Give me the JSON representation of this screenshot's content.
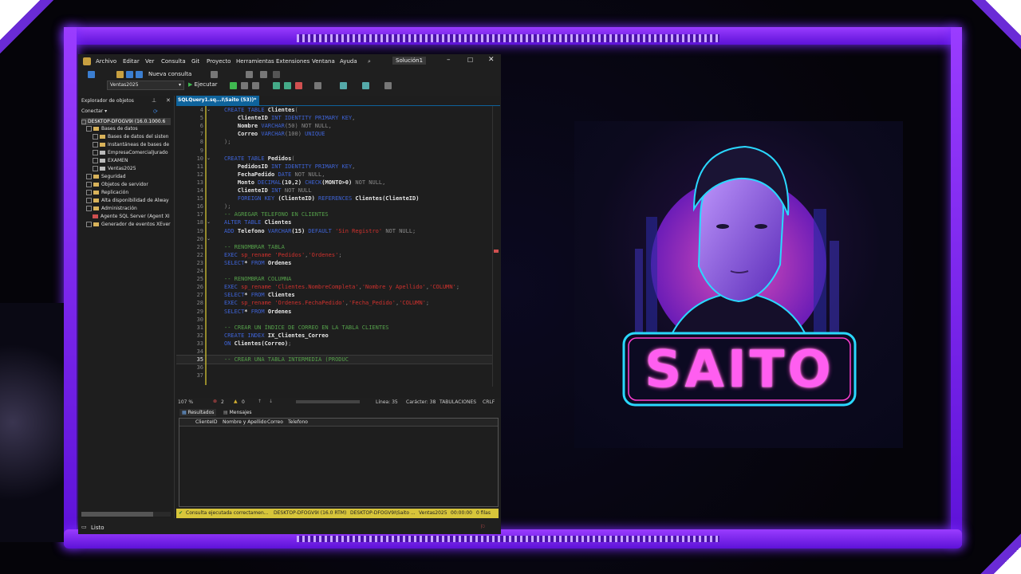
{
  "menu": {
    "items": [
      "Archivo",
      "Editar",
      "Ver",
      "Consulta",
      "Git",
      "Proyecto",
      "Herramientas",
      "Extensiones",
      "Ventana",
      "Ayuda"
    ],
    "solution_badge": "Solución1"
  },
  "toolbar": {
    "new_query": "Nueva consulta",
    "database": "Ventas2025",
    "execute": "Ejecutar"
  },
  "object_explorer": {
    "title": "Explorador de objetos",
    "connect": "Conectar",
    "server": "DESKTOP-DFOGV9I (16.0.1000.6",
    "items": [
      "Bases de datos",
      "Bases de datos del sisten",
      "Instantáneas de bases de",
      "EmpresaComercialJurado",
      "EXAMEN",
      "Ventas2025",
      "Seguridad",
      "Objetos de servidor",
      "Replicación",
      "Alta disponibilidad de Alway",
      "Administración",
      "Agente SQL Server (Agent XI",
      "Generador de eventos XEver"
    ]
  },
  "editor": {
    "tab_label": "SQLQuery1.sq...I\\Saito (53))*",
    "lines": [
      {
        "n": "4",
        "parts": [
          [
            "kw",
            "CREATE TABLE "
          ],
          [
            "tb",
            "Clientes"
          ],
          [
            "gr",
            "("
          ]
        ]
      },
      {
        "n": "5",
        "parts": [
          [
            "tb",
            "    ClienteID "
          ],
          [
            "kw",
            "INT IDENTITY PRIMARY KEY"
          ],
          [
            "gr",
            ","
          ]
        ]
      },
      {
        "n": "6",
        "parts": [
          [
            "tb",
            "    Nombre "
          ],
          [
            "kw",
            "VARCHAR"
          ],
          [
            "gr",
            "(50) NOT NULL,"
          ]
        ]
      },
      {
        "n": "7",
        "parts": [
          [
            "tb",
            "    Correo "
          ],
          [
            "kw",
            "VARCHAR"
          ],
          [
            "gr",
            "(100) "
          ],
          [
            "kw",
            "UNIQUE"
          ]
        ]
      },
      {
        "n": "8",
        "parts": [
          [
            "gr",
            ");"
          ]
        ]
      },
      {
        "n": "9",
        "parts": [
          [
            "gr",
            ""
          ]
        ]
      },
      {
        "n": "10",
        "parts": [
          [
            "kw",
            "CREATE TABLE "
          ],
          [
            "tb",
            "Pedidos"
          ],
          [
            "gr",
            "("
          ]
        ]
      },
      {
        "n": "11",
        "parts": [
          [
            "tb",
            "    PedidosID "
          ],
          [
            "kw",
            "INT IDENTITY PRIMARY KEY"
          ],
          [
            "gr",
            ","
          ]
        ]
      },
      {
        "n": "12",
        "parts": [
          [
            "tb",
            "    FechaPedido "
          ],
          [
            "kw",
            "DATE"
          ],
          [
            "gr",
            " NOT NULL,"
          ]
        ]
      },
      {
        "n": "13",
        "parts": [
          [
            "tb",
            "    Monto "
          ],
          [
            "kw",
            "DECIMAL"
          ],
          [
            "tb",
            "(10,2) "
          ],
          [
            "kw",
            "CHECK"
          ],
          [
            "tb",
            "(MONTO>0)"
          ],
          [
            "gr",
            " NOT NULL,"
          ]
        ]
      },
      {
        "n": "14",
        "parts": [
          [
            "tb",
            "    ClienteID "
          ],
          [
            "kw",
            "INT"
          ],
          [
            "gr",
            " NOT NULL"
          ]
        ]
      },
      {
        "n": "15",
        "parts": [
          [
            "kw",
            "    FOREIGN KEY "
          ],
          [
            "tb",
            "(ClienteID) "
          ],
          [
            "kw",
            "REFERENCES "
          ],
          [
            "tb",
            "Clientes(ClienteID)"
          ]
        ]
      },
      {
        "n": "16",
        "parts": [
          [
            "gr",
            ");"
          ]
        ]
      },
      {
        "n": "17",
        "parts": [
          [
            "cm",
            "-- AGREGAR TELEFONO EN CLIENTES"
          ]
        ]
      },
      {
        "n": "18",
        "parts": [
          [
            "kw",
            "ALTER TABLE "
          ],
          [
            "tb",
            "Clientes"
          ]
        ]
      },
      {
        "n": "19",
        "parts": [
          [
            "kw",
            "ADD "
          ],
          [
            "tb",
            "Telefono "
          ],
          [
            "kw",
            "VARCHAR"
          ],
          [
            "tb",
            "(15) "
          ],
          [
            "kw",
            "DEFAULT "
          ],
          [
            "str",
            "'Sin Registro'"
          ],
          [
            "gr",
            " NOT NULL;"
          ]
        ]
      },
      {
        "n": "20",
        "parts": [
          [
            "gr",
            ""
          ]
        ]
      },
      {
        "n": "21",
        "parts": [
          [
            "cm",
            "-- RENOMBRAR TABLA"
          ]
        ]
      },
      {
        "n": "22",
        "parts": [
          [
            "kw",
            "EXEC "
          ],
          [
            "str",
            "sp_rename "
          ],
          [
            "str",
            "'Pedidos'"
          ],
          [
            "gr",
            ","
          ],
          [
            "str",
            "'Ordenes'"
          ],
          [
            "gr",
            ";"
          ]
        ]
      },
      {
        "n": "23",
        "parts": [
          [
            "kw",
            "SELECT"
          ],
          [
            "tb",
            "* "
          ],
          [
            "kw",
            "FROM "
          ],
          [
            "tb",
            "Ordenes"
          ]
        ]
      },
      {
        "n": "24",
        "parts": [
          [
            "gr",
            ""
          ]
        ]
      },
      {
        "n": "25",
        "parts": [
          [
            "cm",
            "-- RENOMBRAR COLUMNA"
          ]
        ]
      },
      {
        "n": "26",
        "parts": [
          [
            "kw",
            "EXEC "
          ],
          [
            "str",
            "sp_rename "
          ],
          [
            "str",
            "'Clientes.NombreCompleta'"
          ],
          [
            "gr",
            ","
          ],
          [
            "str",
            "'Nombre y Apellido'"
          ],
          [
            "gr",
            ","
          ],
          [
            "str",
            "'COLUMN'"
          ],
          [
            "gr",
            ";"
          ]
        ]
      },
      {
        "n": "27",
        "parts": [
          [
            "kw",
            "SELECT"
          ],
          [
            "tb",
            "* "
          ],
          [
            "kw",
            "FROM "
          ],
          [
            "tb",
            "Clientes"
          ]
        ]
      },
      {
        "n": "28",
        "parts": [
          [
            "kw",
            "EXEC "
          ],
          [
            "str",
            "sp_rename "
          ],
          [
            "str",
            "'Ordenes.FechaPedido'"
          ],
          [
            "gr",
            ","
          ],
          [
            "str",
            "'Fecha_Pedido'"
          ],
          [
            "gr",
            ","
          ],
          [
            "str",
            "'COLUMN'"
          ],
          [
            "gr",
            ";"
          ]
        ]
      },
      {
        "n": "29",
        "parts": [
          [
            "kw",
            "SELECT"
          ],
          [
            "tb",
            "* "
          ],
          [
            "kw",
            "FROM "
          ],
          [
            "tb",
            "Ordenes"
          ]
        ]
      },
      {
        "n": "30",
        "parts": [
          [
            "gr",
            ""
          ]
        ]
      },
      {
        "n": "31",
        "parts": [
          [
            "cm",
            "-- CREAR UN ÍNDICE DE CORREO EN LA TABLA CLIENTES"
          ]
        ]
      },
      {
        "n": "32",
        "parts": [
          [
            "kw",
            "CREATE INDEX "
          ],
          [
            "tb",
            "IX_Clientes_Correo"
          ]
        ]
      },
      {
        "n": "33",
        "parts": [
          [
            "kw",
            "ON "
          ],
          [
            "tb",
            "Clientes(Correo)"
          ],
          [
            "gr",
            ";"
          ]
        ]
      },
      {
        "n": "34",
        "parts": [
          [
            "gr",
            ""
          ]
        ]
      },
      {
        "n": "35",
        "parts": [
          [
            "cm",
            "-- CREAR UNA TABLA INTERMEDIA (PRODUC"
          ]
        ]
      },
      {
        "n": "36",
        "parts": [
          [
            "gr",
            ""
          ]
        ]
      },
      {
        "n": "37",
        "parts": [
          [
            "gr",
            ""
          ]
        ]
      }
    ]
  },
  "status": {
    "zoom": "107 %",
    "errors": "2",
    "warnings": "0",
    "line": "Línea: 35",
    "char": "Carácter: 38",
    "tabs": "TABULACIONES",
    "eol": "CRLF"
  },
  "results": {
    "tabs": [
      "Resultados",
      "Mensajes"
    ],
    "columns": [
      "ClienteID",
      "Nombre y Apellido",
      "Correo",
      "Telefono"
    ]
  },
  "query_status": {
    "message": "Consulta ejecutada correctamen...",
    "server": "DESKTOP-DFOGV9I (16.0 RTM)",
    "user": "DESKTOP-DFOGV9I\\Saito ...",
    "db": "Ventas2025",
    "time": "00:00:00",
    "rows": "0 filas"
  },
  "app_status": "Listo",
  "avatar": {
    "name": "SAITO"
  }
}
